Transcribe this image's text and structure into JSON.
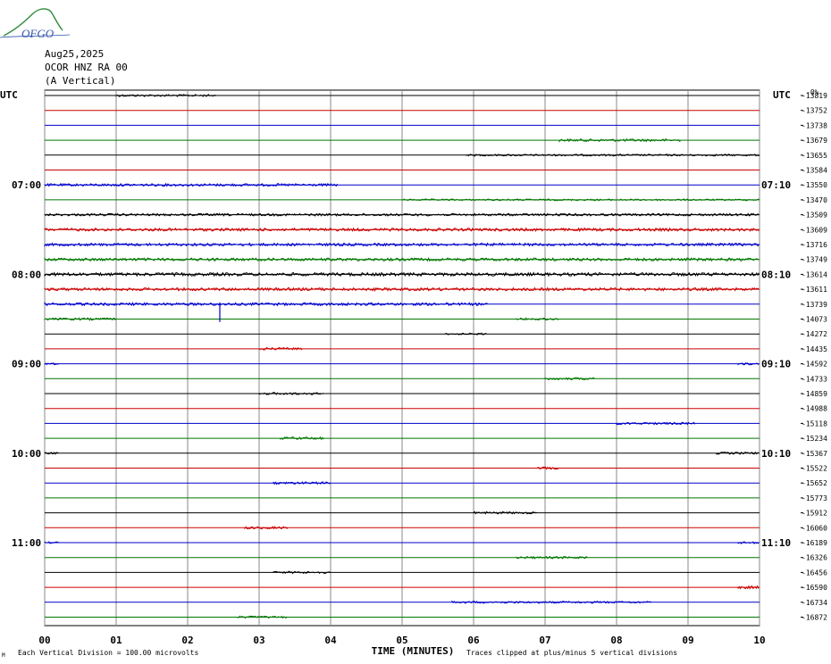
{
  "header": {
    "date": "Aug25,2025",
    "station": "OCOR HNZ RA 00",
    "component": "(A Vertical)",
    "logo_text": "OFGO"
  },
  "chart_data": {
    "type": "line",
    "title": "",
    "utc_label_left": "UTC",
    "utc_label_right": "UTC",
    "right_column_header": "-0%",
    "left_time_labels": [
      {
        "row": 6,
        "label": "07:00"
      },
      {
        "row": 12,
        "label": "08:00"
      },
      {
        "row": 18,
        "label": "09:00"
      },
      {
        "row": 24,
        "label": "10:00"
      },
      {
        "row": 30,
        "label": "11:00"
      }
    ],
    "right_time_labels": [
      {
        "row": 6,
        "label": "07:10"
      },
      {
        "row": 12,
        "label": "08:10"
      },
      {
        "row": 18,
        "label": "09:10"
      },
      {
        "row": 24,
        "label": "10:10"
      },
      {
        "row": 30,
        "label": "11:10"
      }
    ],
    "trace_offsets": [
      -13819,
      -13752,
      -13738,
      -13679,
      -13655,
      -13584,
      -13550,
      -13470,
      -13509,
      -13609,
      -13716,
      -13749,
      -13614,
      -13611,
      -13739,
      -14073,
      -14272,
      -14435,
      -14592,
      -14733,
      -14859,
      -14988,
      -15118,
      -15234,
      -15367,
      -15522,
      -15652,
      -15773,
      -15912,
      -16060,
      -16189,
      -16326,
      -16456,
      -16590,
      -16734,
      -16872
    ],
    "trace_color_cycle": [
      "#000000",
      "#cc0000",
      "#0000cc",
      "#007700"
    ],
    "x_ticks": [
      "00",
      "01",
      "02",
      "03",
      "04",
      "05",
      "06",
      "07",
      "08",
      "09",
      "10"
    ],
    "xlim": [
      0,
      10
    ],
    "xlabel": "TIME (MINUTES)",
    "footer_left": "Each Vertical Division = 100.00 microvolts",
    "footer_right": "Traces clipped at plus/minus 5 vertical divisions",
    "grid": true,
    "noise_segments": [
      {
        "row": 0,
        "x0": 1.0,
        "x1": 2.4,
        "amp": 1.2
      },
      {
        "row": 3,
        "x0": 7.2,
        "x1": 8.9,
        "amp": 1.4
      },
      {
        "row": 4,
        "x0": 5.9,
        "x1": 10.0,
        "amp": 1.0
      },
      {
        "row": 6,
        "x0": 0.0,
        "x1": 4.1,
        "amp": 1.4
      },
      {
        "row": 7,
        "x0": 5.0,
        "x1": 10.0,
        "amp": 0.9
      },
      {
        "row": 8,
        "x0": 0.0,
        "x1": 10.0,
        "amp": 1.3
      },
      {
        "row": 9,
        "x0": 0.0,
        "x1": 10.0,
        "amp": 1.6
      },
      {
        "row": 10,
        "x0": 0.0,
        "x1": 10.0,
        "amp": 1.5
      },
      {
        "row": 11,
        "x0": 0.0,
        "x1": 10.0,
        "amp": 1.6
      },
      {
        "row": 12,
        "x0": 0.0,
        "x1": 10.0,
        "amp": 1.8
      },
      {
        "row": 13,
        "x0": 0.0,
        "x1": 10.0,
        "amp": 1.6
      },
      {
        "row": 14,
        "x0": 0.0,
        "x1": 6.2,
        "amp": 1.5
      },
      {
        "row": 15,
        "x0": 0.0,
        "x1": 1.0,
        "amp": 1.3
      },
      {
        "row": 15,
        "x0": 6.6,
        "x1": 7.2,
        "amp": 1.2
      },
      {
        "row": 16,
        "x0": 5.6,
        "x1": 6.2,
        "amp": 1.0
      },
      {
        "row": 17,
        "x0": 3.0,
        "x1": 3.6,
        "amp": 1.4
      },
      {
        "row": 18,
        "x0": 0.0,
        "x1": 0.2,
        "amp": 1.2
      },
      {
        "row": 18,
        "x0": 9.7,
        "x1": 10.0,
        "amp": 1.2
      },
      {
        "row": 19,
        "x0": 7.0,
        "x1": 7.7,
        "amp": 1.2
      },
      {
        "row": 20,
        "x0": 3.0,
        "x1": 3.9,
        "amp": 1.3
      },
      {
        "row": 22,
        "x0": 8.0,
        "x1": 9.1,
        "amp": 1.2
      },
      {
        "row": 23,
        "x0": 3.3,
        "x1": 3.9,
        "amp": 1.4
      },
      {
        "row": 24,
        "x0": 0.0,
        "x1": 0.2,
        "amp": 1.0
      },
      {
        "row": 24,
        "x0": 9.4,
        "x1": 10.0,
        "amp": 1.2
      },
      {
        "row": 25,
        "x0": 6.9,
        "x1": 7.2,
        "amp": 1.4
      },
      {
        "row": 26,
        "x0": 3.2,
        "x1": 4.0,
        "amp": 1.3
      },
      {
        "row": 28,
        "x0": 6.0,
        "x1": 6.9,
        "amp": 1.2
      },
      {
        "row": 29,
        "x0": 2.8,
        "x1": 3.4,
        "amp": 1.3
      },
      {
        "row": 30,
        "x0": 0.0,
        "x1": 0.2,
        "amp": 1.0
      },
      {
        "row": 30,
        "x0": 9.7,
        "x1": 10.0,
        "amp": 1.2
      },
      {
        "row": 31,
        "x0": 6.6,
        "x1": 7.6,
        "amp": 1.2
      },
      {
        "row": 32,
        "x0": 3.2,
        "x1": 4.0,
        "amp": 1.2
      },
      {
        "row": 33,
        "x0": 9.7,
        "x1": 10.0,
        "amp": 1.6
      },
      {
        "row": 34,
        "x0": 5.7,
        "x1": 8.5,
        "amp": 1.1
      },
      {
        "row": 35,
        "x0": 2.7,
        "x1": 3.4,
        "amp": 1.2
      }
    ],
    "spikes": [
      {
        "row": 14,
        "x": 2.45,
        "amp": 20
      }
    ]
  }
}
